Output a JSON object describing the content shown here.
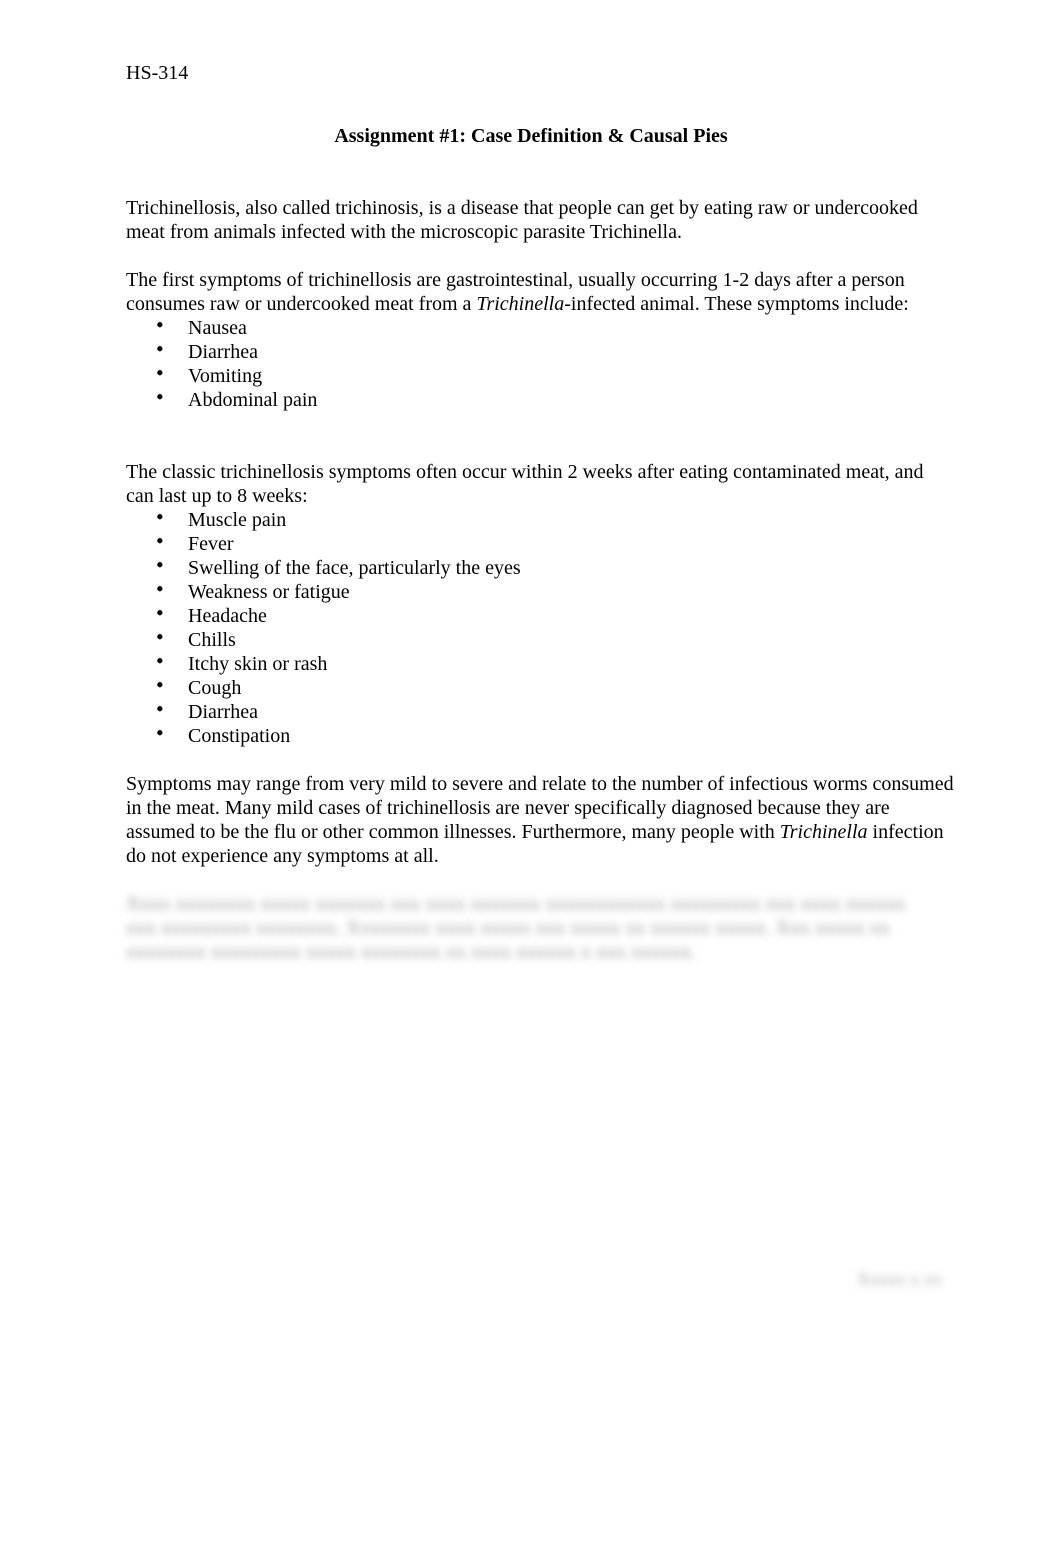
{
  "document": {
    "course_code": "HS-314",
    "title": "Assignment #1: Case Definition & Causal Pies",
    "paragraph_1": "Trichinellosis, also called trichinosis, is a disease that people can get by eating raw or undercooked meat from animals infected with the microscopic parasite Trichinella.",
    "paragraph_2": {
      "part_a": "The first symptoms of trichinellosis are gastrointestinal, usually occurring 1-2 days after a person consumes raw or undercooked meat from a ",
      "italic": "Trichinella",
      "part_b": "-infected animal. These symptoms include:"
    },
    "early_symptoms": [
      "Nausea",
      "Diarrhea",
      "Vomiting",
      "Abdominal pain"
    ],
    "paragraph_3": "The classic trichinellosis symptoms often occur within 2 weeks after eating contaminated meat, and can last up to 8 weeks:",
    "classic_symptoms": [
      "Muscle pain",
      "Fever",
      "Swelling of the face, particularly the eyes",
      "Weakness or fatigue",
      "Headache",
      "Chills",
      "Itchy skin or rash",
      "Cough",
      "Diarrhea",
      "Constipation"
    ],
    "paragraph_4": {
      "part_a": "Symptoms may range from very mild to severe and relate to the number of infectious worms consumed in the meat. Many mild cases of trichinellosis are never specifically diagnosed because they are assumed to be the flu or other common illnesses. Furthermore, many people with ",
      "italic": "Trichinella",
      "part_b": " infection do not experience any symptoms at all."
    },
    "blurred_paragraph": "[obscured text — unreadable]",
    "blurred_footer": "[obscured]",
    "bullet_glyph": "•"
  }
}
